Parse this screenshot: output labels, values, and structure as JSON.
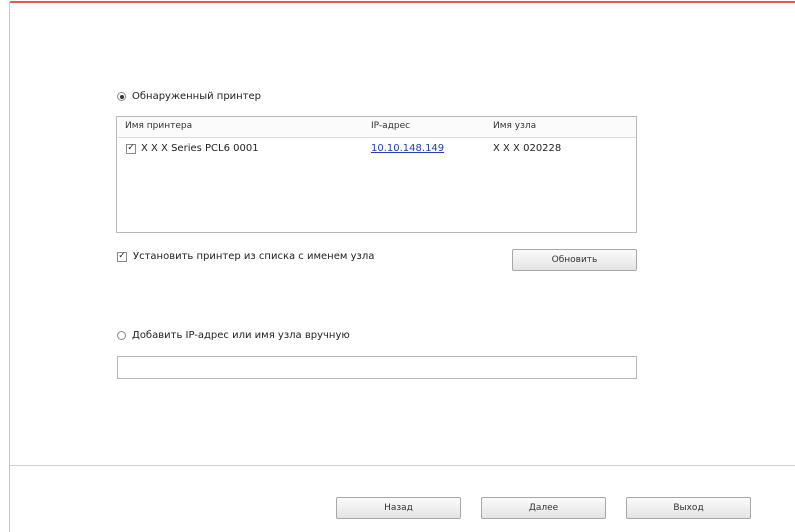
{
  "detected": {
    "radio_label": "Обнаруженный принтер",
    "selected": true
  },
  "printer_table": {
    "columns": [
      "Имя принтера",
      "IP-адрес",
      "Имя узла"
    ],
    "rows": [
      {
        "checked": true,
        "name": "X X X  Series PCL6 0001",
        "ip": "10.10.148.149",
        "host": "X X X 020228"
      }
    ]
  },
  "install_by_host": {
    "label": "Установить принтер из списка с именем узла",
    "checked": true,
    "check_mark": "✓"
  },
  "refresh_button": "Обновить",
  "manual": {
    "radio_label": "Добавить IP-адрес или имя узла вручную",
    "selected": false,
    "input_value": ""
  },
  "footer": {
    "back": "Назад",
    "next": "Далее",
    "exit": "Выход"
  }
}
